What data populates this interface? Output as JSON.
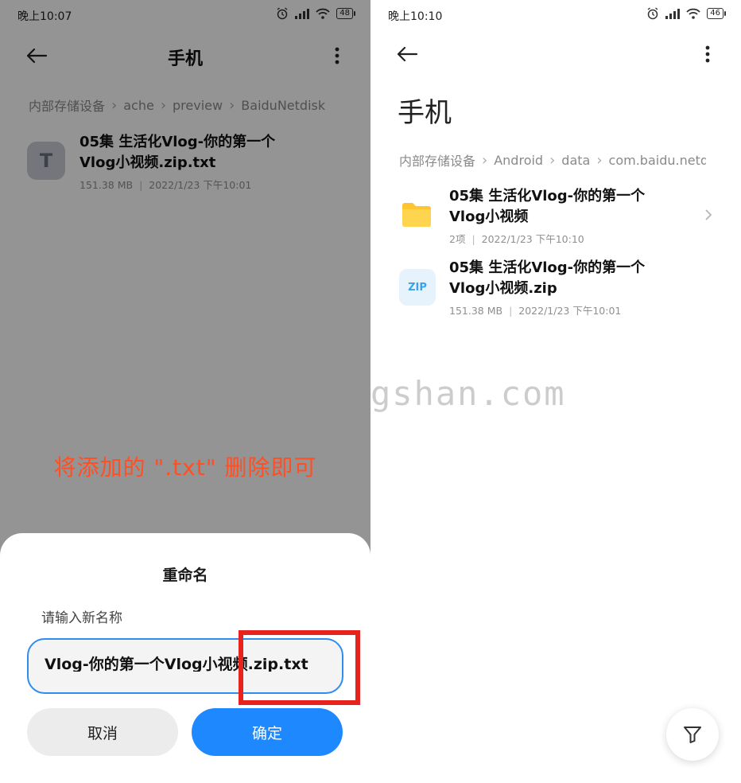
{
  "left": {
    "status": {
      "time": "晚上10:07",
      "battery": "48"
    },
    "appbar": {
      "title": "手机"
    },
    "breadcrumb": [
      "内部存储设备",
      "ache",
      "preview",
      "BaiduNetdisk"
    ],
    "file": {
      "icon": "text-file-icon",
      "icon_letter": "T",
      "name_line1": "05集 生活化Vlog-你的第一个",
      "name_line2": "Vlog小视频.zip.txt",
      "size": "151.38 MB",
      "date": "2022/1/23 下午10:01"
    },
    "instruction": "将添加的 \".txt\" 删除即可",
    "dialog": {
      "title": "重命名",
      "label": "请输入新名称",
      "input_value": "Vlog-你的第一个Vlog小视频.zip.txt",
      "cancel": "取消",
      "confirm": "确定"
    }
  },
  "right": {
    "status": {
      "time": "晚上10:10",
      "battery": "46"
    },
    "title": "手机",
    "breadcrumb": [
      "内部存储设备",
      "Android",
      "data",
      "com.baidu.netd"
    ],
    "items": [
      {
        "icon": "folder-icon",
        "name_line1": "05集 生活化Vlog-你的第一个",
        "name_line2": "Vlog小视频",
        "count": "2项",
        "date": "2022/1/23 下午10:10"
      },
      {
        "icon": "zip-icon",
        "icon_label": "ZIP",
        "name_line1": "05集 生活化Vlog-你的第一个",
        "name_line2": "Vlog小视频.zip",
        "size": "151.38 MB",
        "date": "2022/1/23 下午10:01"
      }
    ],
    "watermark": "gshan.com"
  },
  "colors": {
    "accent": "#1e88ff",
    "instruction": "#ff4f24",
    "highlight_box": "#e8231d",
    "folder": "#ffc531"
  }
}
